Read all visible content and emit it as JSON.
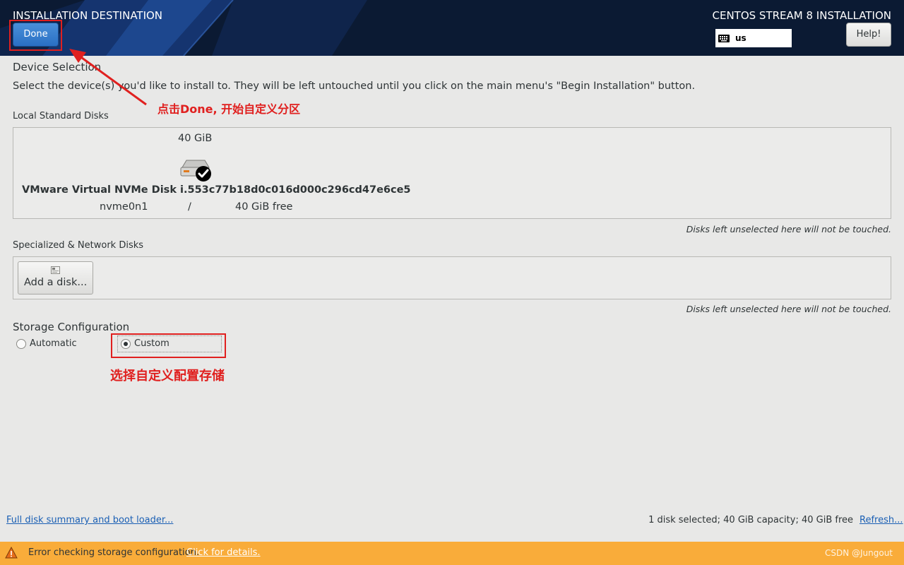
{
  "header": {
    "title": "INSTALLATION DESTINATION",
    "product": "CENTOS STREAM 8 INSTALLATION",
    "done_label": "Done",
    "keyboard_layout": "us",
    "help_label": "Help!"
  },
  "device_selection": {
    "title": "Device Selection",
    "description": "Select the device(s) you'd like to install to.  They will be left untouched until you click on the main menu's \"Begin Installation\" button."
  },
  "local_disks": {
    "title": "Local Standard Disks",
    "disk": {
      "size": "40 GiB",
      "name": "VMware Virtual NVMe Disk i.553c77b18d0c016d000c296cd47e6ce5",
      "device": "nvme0n1",
      "mount": "/",
      "free": "40 GiB free",
      "selected": true
    },
    "note": "Disks left unselected here will not be touched."
  },
  "network_disks": {
    "title": "Specialized & Network Disks",
    "add_disk_label": "Add a disk...",
    "note": "Disks left unselected here will not be touched."
  },
  "storage_config": {
    "title": "Storage Configuration",
    "options": [
      "Automatic",
      "Custom"
    ],
    "selected": "Custom"
  },
  "annotations": {
    "done_hint": "点击Done, 开始自定义分区",
    "custom_hint": "选择自定义配置存储"
  },
  "footer": {
    "summary_link": "Full disk summary and boot loader...",
    "summary_text": "1 disk selected; 40 GiB capacity; 40 GiB free",
    "refresh_link": "Refresh..."
  },
  "error_bar": {
    "message": "Error checking storage configuration.",
    "link": "Click for details.",
    "watermark": "CSDN @Jungout"
  },
  "colors": {
    "header_bg": "#0b1a33",
    "accent_blue": "#2a6fc4",
    "annotation_red": "#e0201f",
    "error_bar": "#f9ac3a"
  }
}
